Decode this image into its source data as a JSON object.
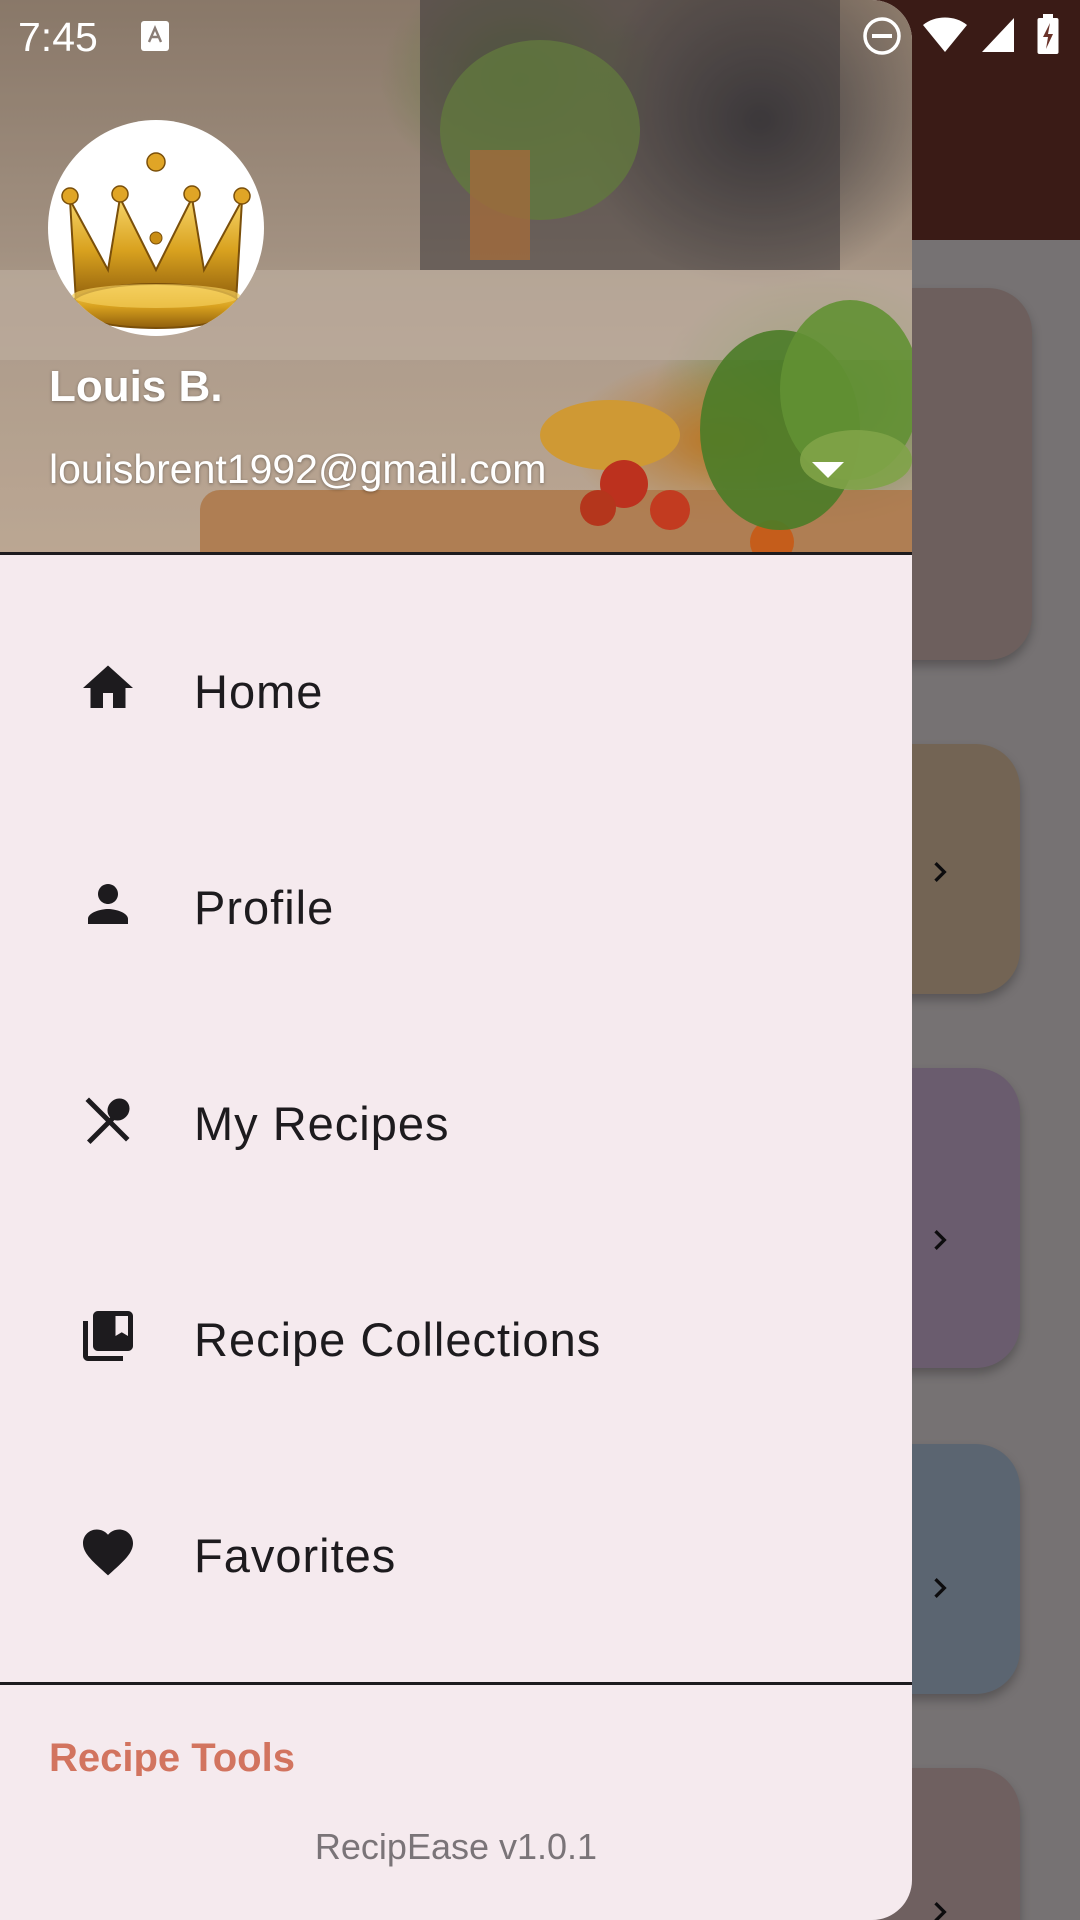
{
  "status_bar": {
    "time": "7:45",
    "icons": [
      "keyboard-notification-icon",
      "do-not-disturb-icon",
      "wifi-icon",
      "cellular-signal-icon",
      "battery-charging-icon"
    ]
  },
  "background_screen": {
    "appbar_color": "#7a3a2f",
    "cards": [
      {
        "color": "#e3c7c2"
      },
      {
        "color": "#f1d2b0"
      },
      {
        "color": "#dec0e6"
      },
      {
        "color": "#bfd3ec"
      },
      {
        "color": "#e8c8c8"
      }
    ]
  },
  "drawer": {
    "header": {
      "avatar_icon": "crown-icon",
      "user_name": "Louis B.",
      "user_email": "louisbrent1992@gmail.com"
    },
    "items": [
      {
        "label": "Home",
        "icon": "home-icon"
      },
      {
        "label": "Profile",
        "icon": "person-icon"
      },
      {
        "label": "My Recipes",
        "icon": "fork-spoon-icon"
      },
      {
        "label": "Recipe Collections",
        "icon": "collections-icon"
      },
      {
        "label": "Favorites",
        "icon": "heart-icon"
      }
    ],
    "section_title": "Recipe Tools",
    "version": "RecipEase v1.0.1",
    "accent_color": "#d2745f"
  }
}
